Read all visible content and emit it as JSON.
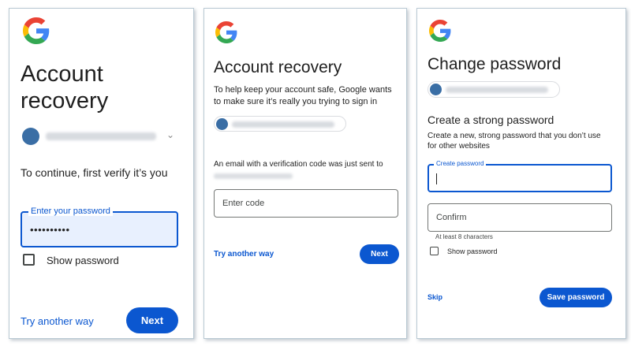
{
  "colors": {
    "accent": "#0b57d0",
    "text": "#1f1f1f",
    "muted": "#444746",
    "border": "#747775"
  },
  "icons": {
    "logo": "google-g-logo",
    "dropdown": "chevron-down-icon"
  },
  "panel1": {
    "title": "Account recovery",
    "subtitle": "To continue, first verify it’s you",
    "password_label": "Enter your password",
    "password_value": "••••••••••",
    "show_password": "Show password",
    "try_another": "Try another way",
    "next": "Next"
  },
  "panel2": {
    "title": "Account recovery",
    "description": "To help keep your account safe, Google wants to make sure it’s really you trying to sign in",
    "sent_text": "An email with a verification code was just sent to",
    "code_placeholder": "Enter code",
    "try_another": "Try another way",
    "next": "Next"
  },
  "panel3": {
    "title": "Change password",
    "section_title": "Create a strong password",
    "description": "Create a new, strong password that you don’t use for other websites",
    "create_label": "Create password",
    "confirm_placeholder": "Confirm",
    "hint": "At least 8 characters",
    "show_password": "Show password",
    "skip": "Skip",
    "save": "Save password"
  }
}
